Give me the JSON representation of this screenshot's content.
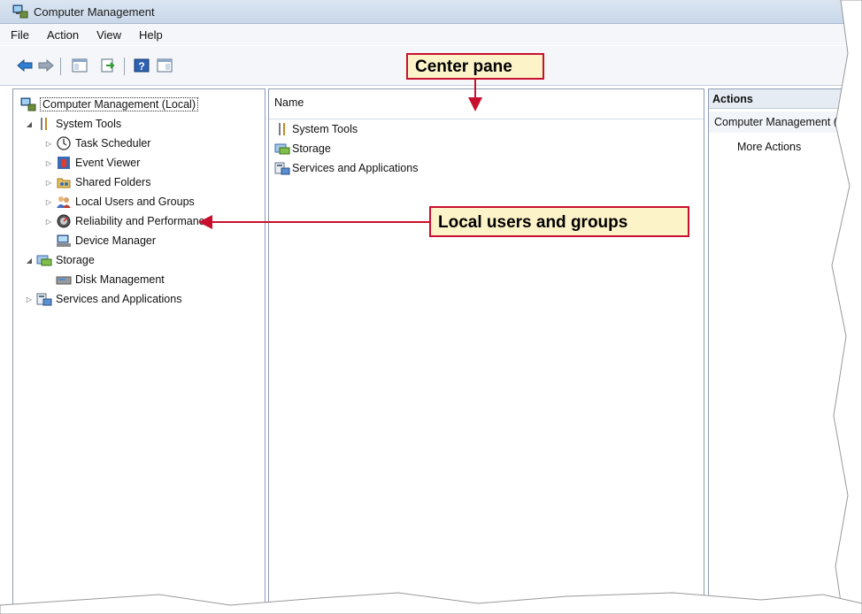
{
  "window": {
    "title": "Computer Management"
  },
  "menu": [
    "File",
    "Action",
    "View",
    "Help"
  ],
  "tree": {
    "root": "Computer Management (Local)",
    "items": [
      {
        "label": "System Tools",
        "icon": "tools-icon"
      },
      {
        "label": "Task Scheduler",
        "icon": "clock-icon"
      },
      {
        "label": "Event Viewer",
        "icon": "event-viewer-icon"
      },
      {
        "label": "Shared Folders",
        "icon": "shared-folder-icon"
      },
      {
        "label": "Local Users and Groups",
        "icon": "users-icon"
      },
      {
        "label": "Reliability and Performance",
        "icon": "performance-icon"
      },
      {
        "label": "Device Manager",
        "icon": "device-manager-icon"
      },
      {
        "label": "Storage",
        "icon": "storage-icon"
      },
      {
        "label": "Disk Management",
        "icon": "disk-icon"
      },
      {
        "label": "Services and Applications",
        "icon": "services-icon"
      }
    ]
  },
  "center": {
    "column_header": "Name",
    "rows": [
      "System Tools",
      "Storage",
      "Services and Applications"
    ]
  },
  "actions": {
    "header": "Actions",
    "subheader": "Computer Management (Local)",
    "more": "More Actions"
  },
  "callouts": {
    "center_pane": "Center pane",
    "local_users": "Local users and groups"
  },
  "colors": {
    "callout_border": "#c8102e",
    "callout_fill": "#fdf3c8"
  }
}
